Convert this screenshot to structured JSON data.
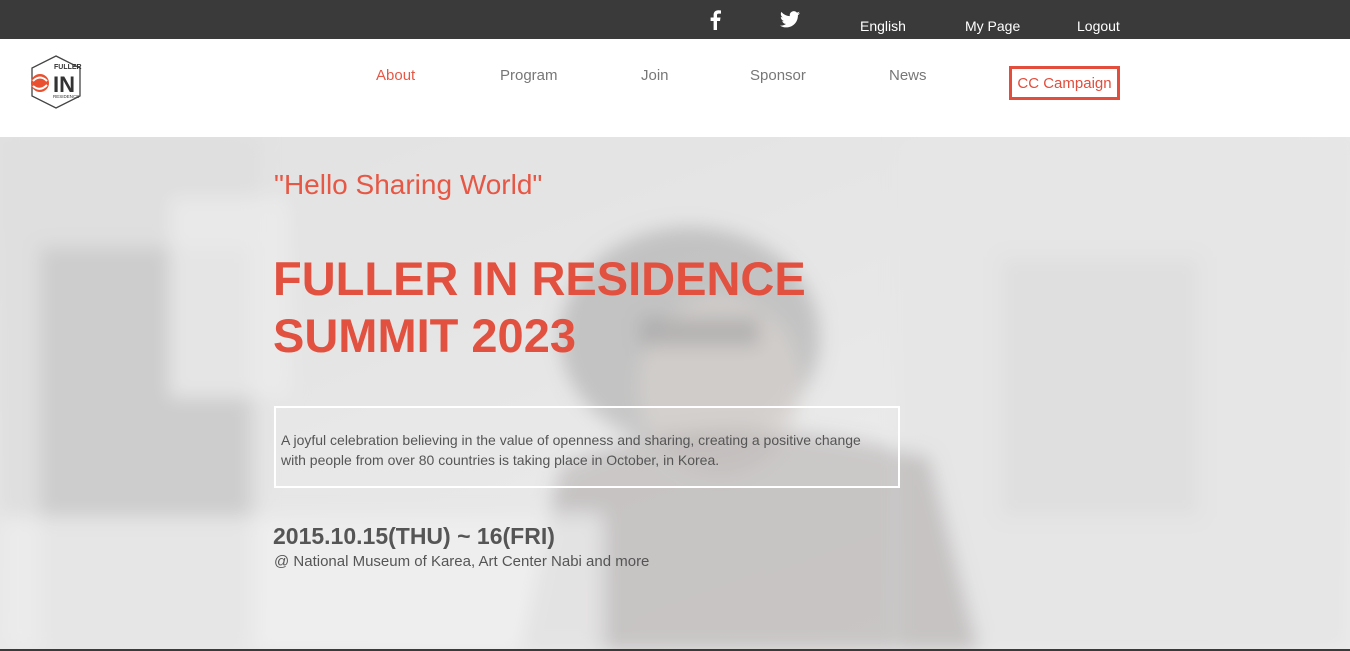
{
  "topbar": {
    "social": [
      {
        "name": "facebook-icon",
        "glyph": "f"
      },
      {
        "name": "twitter-icon"
      }
    ],
    "language": "English",
    "my_page": "My Page",
    "logout": "Logout"
  },
  "header": {
    "logo": {
      "line1": "FULLER",
      "line2": "IN",
      "line3": "RESIDENCE"
    },
    "nav": [
      {
        "label": "About",
        "active": true
      },
      {
        "label": "Program",
        "active": false
      },
      {
        "label": "Join",
        "active": false
      },
      {
        "label": "Sponsor",
        "active": false
      },
      {
        "label": "News",
        "active": false
      }
    ],
    "cta": "CC Campaign"
  },
  "hero": {
    "tagline": "\"Hello Sharing World\"",
    "title_line1": "FULLER IN RESIDENCE",
    "title_line2": "SUMMIT 2023",
    "description": "A joyful celebration believing in the value of openness and sharing, creating a positive change with people from over 80 countries is taking place in October, in Korea.",
    "date": "2015.10.15(THU) ~ 16(FRI)",
    "venue": "@ National Museum of Karea, Art Center Nabi and more"
  },
  "colors": {
    "accent": "#e65745",
    "topbar_bg": "#3a3a3a",
    "nav_text": "#777777",
    "body_text": "#555555"
  }
}
